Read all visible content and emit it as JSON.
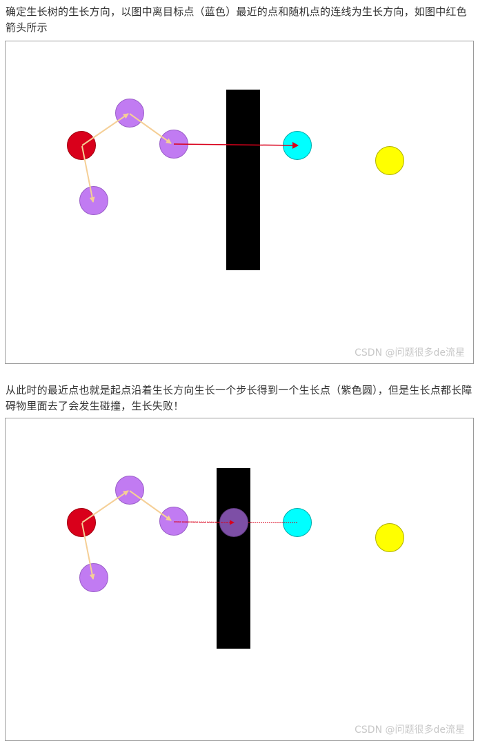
{
  "paragraphs": {
    "intro": "确定生长树的生长方向，以图中离目标点（蓝色）最近的点和随机点的连线为生长方向，如图中红色箭头所示",
    "collision": "从此时的最近点也就是起点沿着生长方向生长一个步长得到一个生长点（紫色圆），但是生长点都长障碍物里面去了会发生碰撞，生长失败！"
  },
  "watermark": "CSDN @问题很多de流星",
  "colors": {
    "start_node": "#d9001b",
    "tree_node": "#c17bf2",
    "target_node": "#00ffff",
    "random_node": "#ffff00",
    "obstacle": "#000000",
    "tree_edge": "#f5cf96",
    "direction_arrow": "#d9001b",
    "collision_node": "#7d4fa6"
  }
}
